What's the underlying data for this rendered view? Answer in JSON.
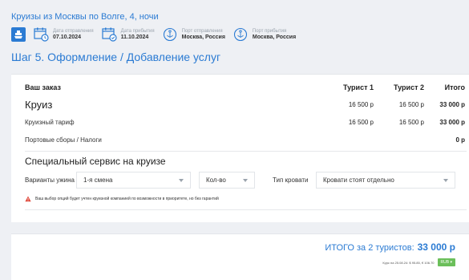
{
  "header": {
    "cruise_title": "Круизы из Москвы по Волге, 4, ночи",
    "departure_label": "Дата отправления",
    "departure_date": "07.10.2024",
    "arrival_label": "Дата прибытия",
    "arrival_date": "11.10.2024",
    "port_from_label": "Порт отправления",
    "port_from": "Москва, Россия",
    "port_to_label": "Порт прибытия",
    "port_to": "Москва, Россия",
    "step_title": "Шаг 5.  Оформление / Добавление услуг"
  },
  "order": {
    "title": "Ваш заказ",
    "col_tourist1": "Турист 1",
    "col_tourist2": "Турист 2",
    "col_total": "Итого",
    "rows": [
      {
        "label": "Круиз",
        "t1": "16 500 р",
        "t2": "16 500 р",
        "total": "33 000 р"
      },
      {
        "label": "Круизный тариф",
        "t1": "16 500 р",
        "t2": "16 500 р",
        "total": "33 000 р"
      },
      {
        "label": "Портовые сборы / Налоги",
        "t1": "",
        "t2": "",
        "total": "0 р"
      }
    ]
  },
  "services": {
    "title": "Специальный сервис на круизе",
    "dinner_label": "Варианты ужина",
    "dinner_value": "1-я смена",
    "qty_value": "Кол-во",
    "bed_label": "Тип кровати",
    "bed_value": "Кровати стоят отдельно",
    "warning": "Ваш выбор опций будет учтен круизной компанией по возможности в приоритете, но без гарантий"
  },
  "total": {
    "label": "ИТОГО за 2 туристов:",
    "amount": "33 000 р",
    "rate": "Курс на 25.08.24: $ 95.85, € 106.70",
    "currency": "RUB ▾"
  },
  "colors": {
    "accent": "#2b7bd3",
    "warning": "#e04a3c",
    "currency_button": "#6bbf5a"
  }
}
